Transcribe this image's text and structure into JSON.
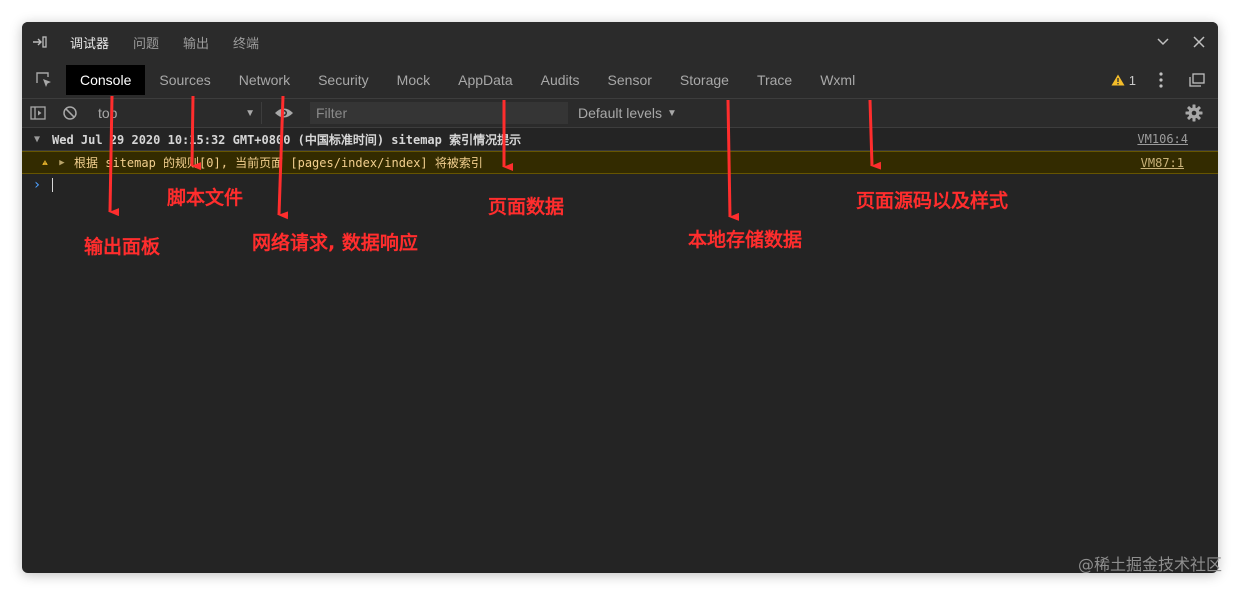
{
  "panel_tabs": [
    "调试器",
    "问题",
    "输出",
    "终端"
  ],
  "devtools_tabs": [
    "Console",
    "Sources",
    "Network",
    "Security",
    "Mock",
    "AppData",
    "Audits",
    "Sensor",
    "Storage",
    "Trace",
    "Wxml"
  ],
  "warning_count": "1",
  "toolbar": {
    "context": "top",
    "filter_placeholder": "Filter",
    "levels": "Default levels"
  },
  "console": {
    "group_header": "Wed Jul 29 2020 10:15:32 GMT+0800 (中国标准时间) sitemap 索引情况提示",
    "group_source": "VM106:4",
    "warning_text": "根据 sitemap 的规则[0], 当前页面 [pages/index/index] 将被索引",
    "warning_source": "VM87:1"
  },
  "annotations": {
    "output_panel": "输出面板",
    "script_files": "脚本文件",
    "network": "网络请求, 数据响应",
    "page_data": "页面数据",
    "local_storage": "本地存储数据",
    "page_source": "页面源码以及样式"
  },
  "watermark": "@稀土掘金技术社区",
  "colors": {
    "window_bg": "#242424",
    "annotation": "#ff2d2d",
    "warning_bg": "#332b00",
    "warning_text": "#f2cf8e",
    "prompt": "#4ea1ff"
  }
}
